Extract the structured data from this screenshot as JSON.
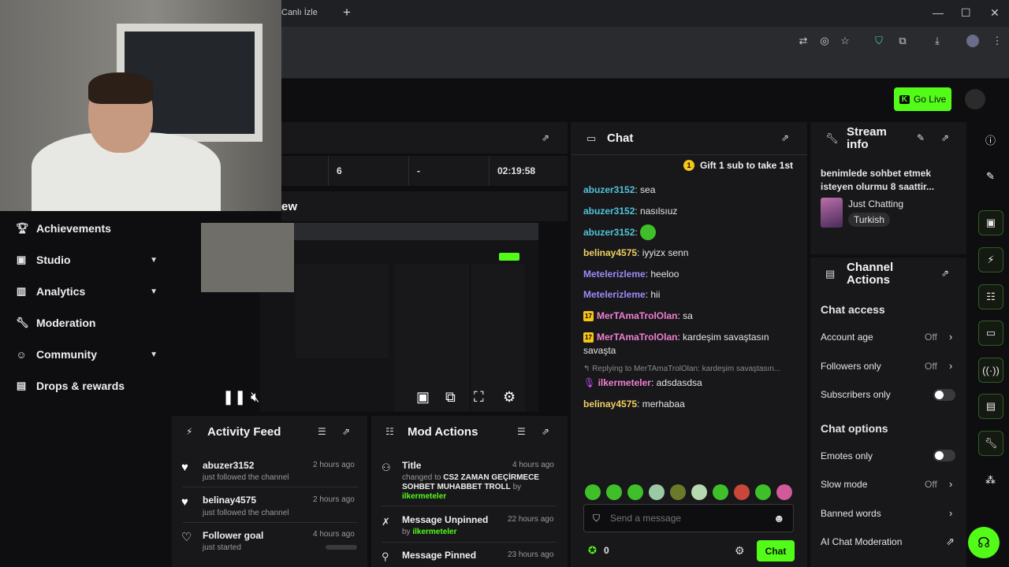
{
  "browser": {
    "tab_title": "Canlı İzle",
    "tab_close": "×",
    "new_tab": "+",
    "minimize": "—",
    "maximize": "☐",
    "close": "✕"
  },
  "topbar": {
    "go_live": "Go Live"
  },
  "sidebar": {
    "items": [
      {
        "label": "Achievements",
        "icon": "trophy-icon"
      },
      {
        "label": "Studio",
        "icon": "studio-icon"
      },
      {
        "label": "Analytics",
        "icon": "analytics-icon"
      },
      {
        "label": "Moderation",
        "icon": "wrench-icon"
      },
      {
        "label": "Community",
        "icon": "community-icon"
      },
      {
        "label": "Drops & rewards",
        "icon": "gift-icon"
      }
    ]
  },
  "stats": {
    "viewers": "6",
    "followers": "-",
    "uptime": "02:19:58"
  },
  "preview": {
    "title_fragment": "ew"
  },
  "activity_feed": {
    "title": "Activity Feed",
    "items": [
      {
        "name": "abuzer3152",
        "sub": "just followed the channel",
        "time": "2 hours ago"
      },
      {
        "name": "belinay4575",
        "sub": "just followed the channel",
        "time": "2 hours ago"
      },
      {
        "name": "Follower goal",
        "sub": "just started",
        "time": "4 hours ago"
      }
    ]
  },
  "mod_actions": {
    "title": "Mod Actions",
    "items": [
      {
        "title": "Title",
        "time": "4 hours ago",
        "changed_to": "changed to",
        "value": "CS2 ZAMAN GEÇİRMECE SOHBET MUHABBET TROLL",
        "by": "by",
        "user": "ilkermeteler"
      },
      {
        "title": "Message Unpinned",
        "time": "22 hours ago",
        "by": "by",
        "user": "ilkermeteler"
      },
      {
        "title": "Message Pinned",
        "time": "23 hours ago"
      }
    ]
  },
  "chat": {
    "title": "Chat",
    "gift": "Gift 1 sub to take 1st",
    "messages": [
      {
        "user": "abuzer3152",
        "text": "sea",
        "color": "#4fc3d9"
      },
      {
        "user": "abuzer3152",
        "text": "nasılsıuz",
        "color": "#4fc3d9"
      },
      {
        "user": "abuzer3152",
        "text": "",
        "color": "#4fc3d9"
      },
      {
        "user": "belinay4575",
        "text": "iyyizx senn",
        "color": "#f0d060"
      },
      {
        "user": "Metelerizleme",
        "text": "heeloo",
        "color": "#9a8cf5"
      },
      {
        "user": "Metelerizleme",
        "text": "hii",
        "color": "#9a8cf5"
      },
      {
        "user": "MerTAmaTrolOlan",
        "text": "sa",
        "color": "#f07fd0",
        "badge": "17"
      },
      {
        "user": "MerTAmaTrolOlan",
        "text": "kardeşim savaştasın savaşta",
        "color": "#f07fd0",
        "badge": "17"
      },
      {
        "user": "ilkermeteler",
        "text": "adsdasdsa",
        "color": "#f07fd0"
      },
      {
        "user": "belinay4575",
        "text": "merhabaa",
        "color": "#f0d060"
      }
    ],
    "reply_note": "Replying to MerTAmaTrolOlan: kardeşim savaştasın...",
    "placeholder": "Send a message",
    "points": "0",
    "send": "Chat"
  },
  "stream_info": {
    "title": "Stream info",
    "stream_title": "benimlede sohbet etmek isteyen olurmu 8 saattir...",
    "category": "Just Chatting",
    "language": "Turkish"
  },
  "channel_actions": {
    "title": "Channel Actions",
    "chat_access": "Chat access",
    "account_age": "Account age",
    "account_age_val": "Off",
    "followers_only": "Followers only",
    "followers_only_val": "Off",
    "subscribers_only": "Subscribers only",
    "chat_options": "Chat options",
    "emotes_only": "Emotes only",
    "slow_mode": "Slow mode",
    "slow_mode_val": "Off",
    "banned_words": "Banned words",
    "ai_moderation": "AI Chat Moderation"
  },
  "colors": {
    "accent": "#53fc18",
    "panel": "#18181b",
    "bg": "#0e0e10"
  }
}
